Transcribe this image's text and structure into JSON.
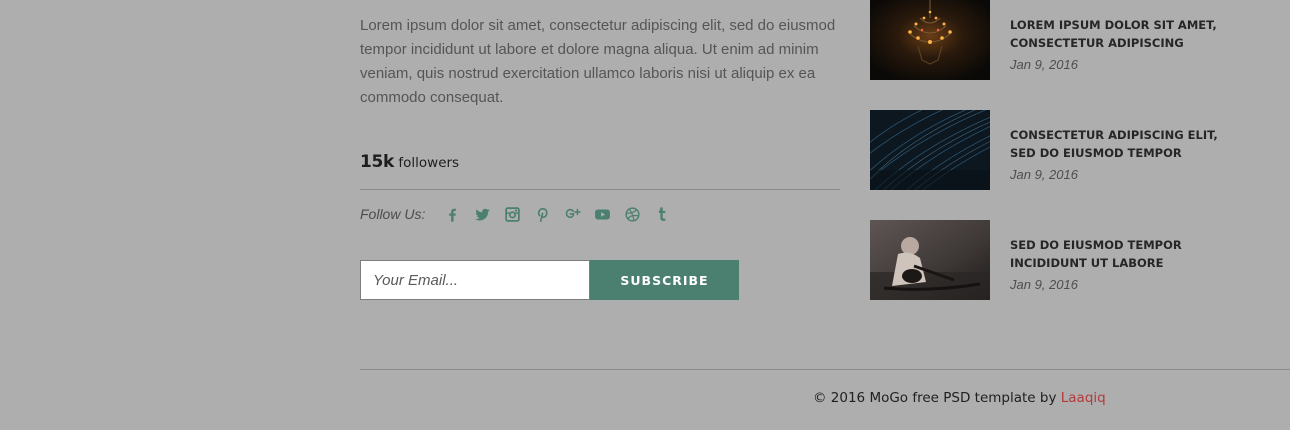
{
  "about": {
    "text": "Lorem ipsum dolor sit amet, consectetur adipiscing elit, sed do eiusmod tempor incididunt ut labore et dolore magna aliqua. Ut enim ad minim veniam, quis nostrud exercitation ullamco laboris nisi ut aliquip ex ea commodo consequat."
  },
  "followers": {
    "count": "15k",
    "label": "followers"
  },
  "follow": {
    "label": "Follow Us:",
    "icons": [
      "facebook-icon",
      "twitter-icon",
      "instagram-icon",
      "pinterest-icon",
      "google-plus-icon",
      "youtube-icon",
      "dribbble-icon",
      "tumblr-icon"
    ],
    "icon_color": "#4b7f6f"
  },
  "subscribe": {
    "email_placeholder": "Your Email...",
    "button_label": "SUBSCRIBE",
    "button_color": "#4b7f6f"
  },
  "posts": [
    {
      "title": "LOREM IPSUM DOLOR SIT AMET, CONSECTETUR ADIPISCING",
      "date": "Jan 9, 2016",
      "thumb": "chandelier-image"
    },
    {
      "title": "CONSECTETUR ADIPISCING ELIT, SED DO EIUSMOD TEMPOR",
      "date": "Jan 9, 2016",
      "thumb": "star-trails-image"
    },
    {
      "title": "SED DO EIUSMOD TEMPOR INCIDIDUNT UT LABORE",
      "date": "Jan 9, 2016",
      "thumb": "guitarist-image"
    }
  ],
  "footer": {
    "copyright": "© 2016 MoGo free PSD template by",
    "author": "Laaqiq",
    "author_color": "#b33a3a"
  }
}
